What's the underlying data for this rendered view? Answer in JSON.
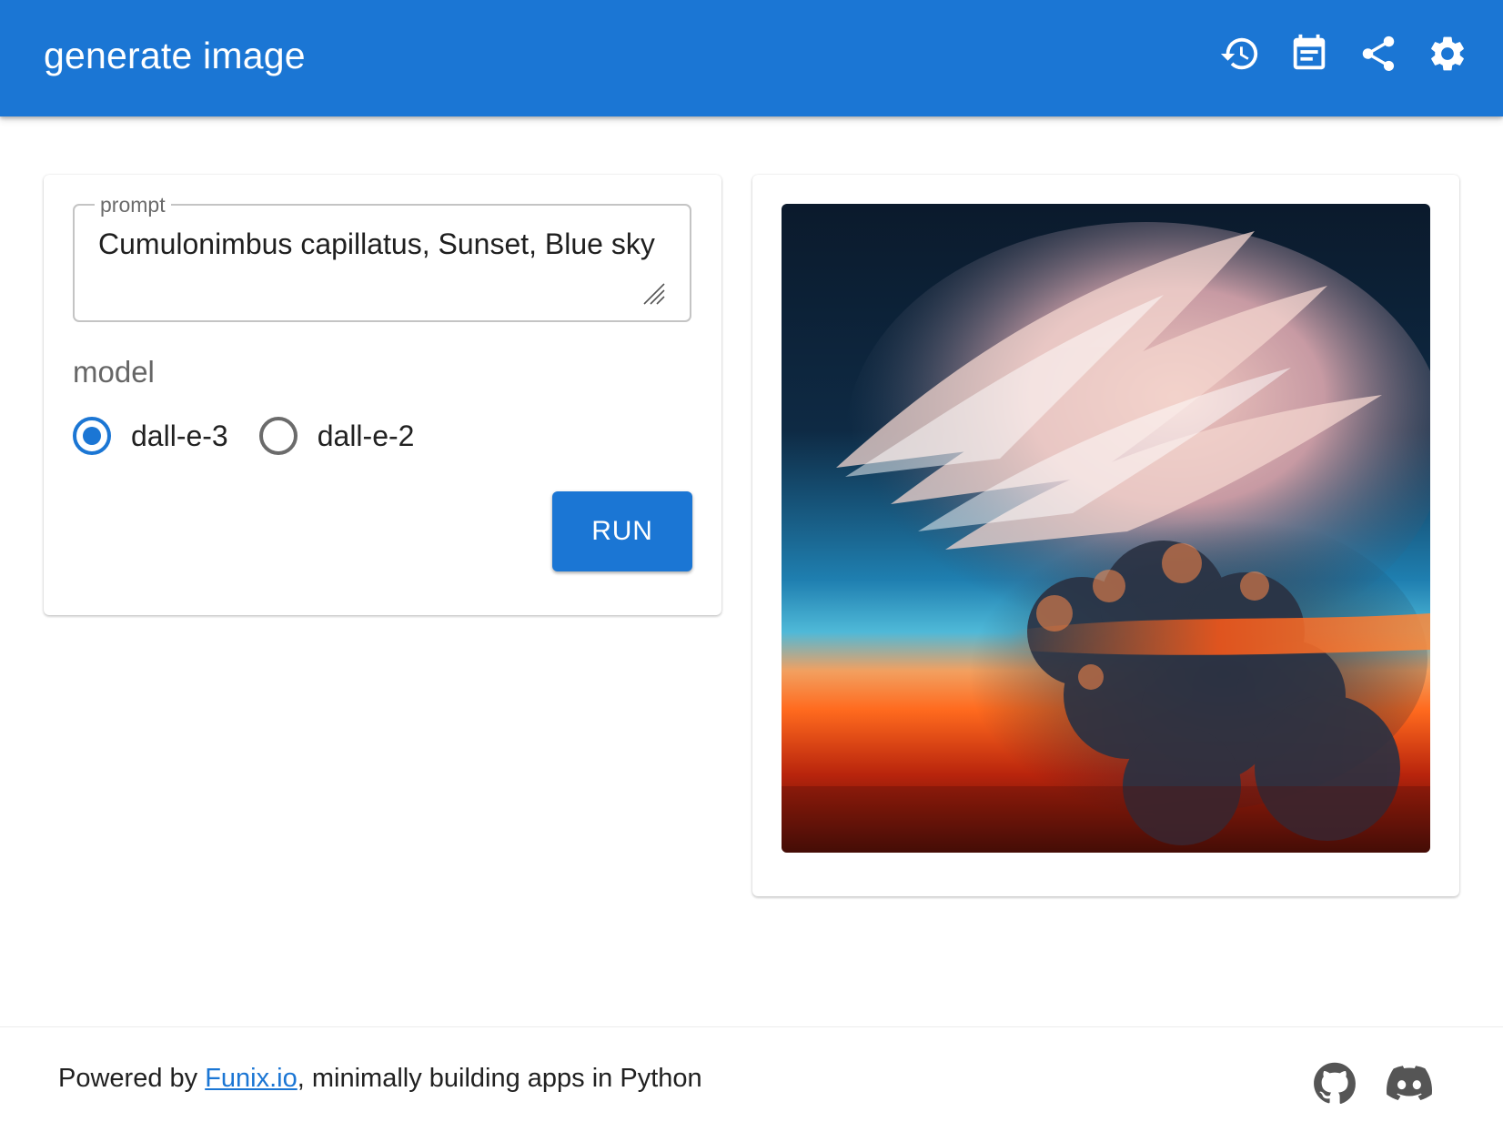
{
  "appbar": {
    "title": "generate image",
    "icons": [
      "history-icon",
      "notes-icon",
      "share-icon",
      "settings-icon"
    ]
  },
  "form": {
    "prompt": {
      "label": "prompt",
      "value": "Cumulonimbus capillatus, Sunset, Blue sky"
    },
    "model": {
      "label": "model",
      "options": [
        {
          "label": "dall-e-3",
          "selected": true
        },
        {
          "label": "dall-e-2",
          "selected": false
        }
      ]
    },
    "run_label": "RUN"
  },
  "output": {
    "image_alt": ""
  },
  "footer": {
    "prefix": "Powered by ",
    "link_text": "Funix.io",
    "suffix": ", minimally building apps in Python",
    "icons": [
      "github-icon",
      "discord-icon"
    ]
  },
  "colors": {
    "primary": "#1b76d4",
    "surface": "#ffffff"
  }
}
